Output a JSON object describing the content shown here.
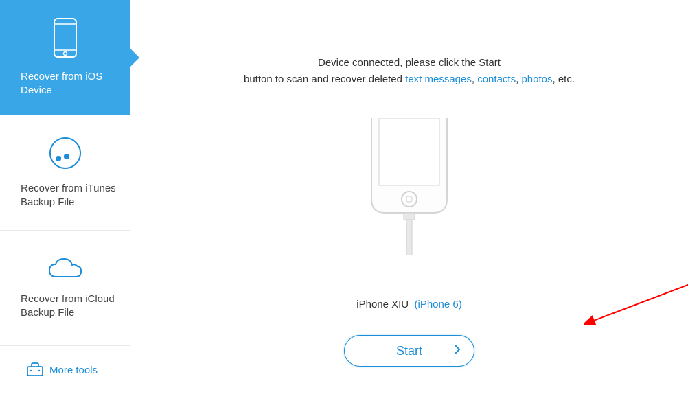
{
  "sidebar": {
    "items": [
      {
        "label": "Recover from iOS Device",
        "active": true
      },
      {
        "label": "Recover from iTunes Backup File",
        "active": false
      },
      {
        "label": "Recover from iCloud Backup File",
        "active": false
      }
    ],
    "more_label": "More tools"
  },
  "main": {
    "instruction_line1": "Device connected, please click the Start",
    "instruction_line2a": "button to scan and recover deleted ",
    "instruction_link1": "text messages",
    "instruction_sep1": ", ",
    "instruction_link2": "contacts",
    "instruction_sep2": ", ",
    "instruction_link3": "photos",
    "instruction_line2b": ", etc.",
    "device_name": "iPhone XIU",
    "device_model": "(iPhone 6)",
    "start_label": "Start"
  },
  "colors": {
    "accent": "#1c8dd8",
    "sidebar_active": "#39a6e8"
  }
}
